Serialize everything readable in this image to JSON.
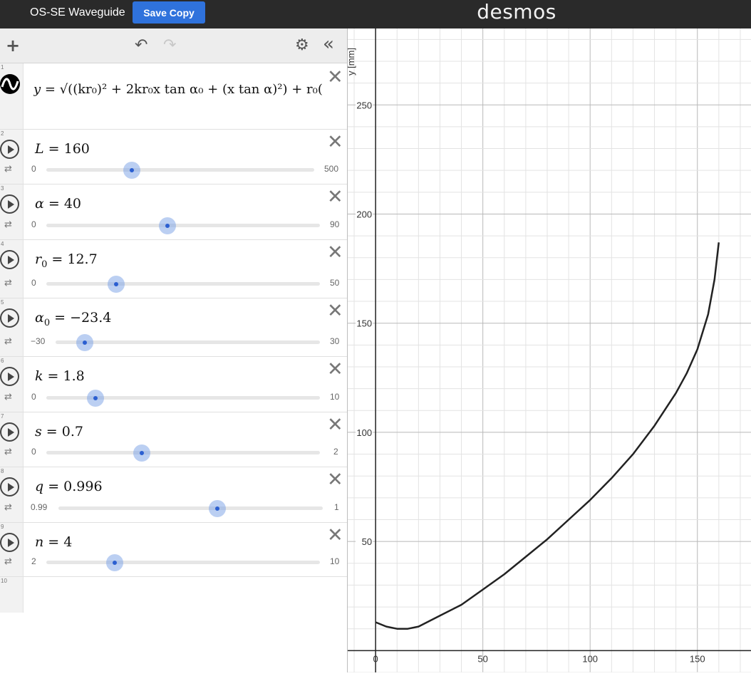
{
  "app": {
    "graph_title": "OS-SE Waveguide",
    "save_label": "Save Copy",
    "brand": "desmos"
  },
  "toolbar": {
    "add_icon": "plus-icon",
    "undo_icon": "undo-icon",
    "redo_icon": "redo-icon",
    "settings_icon": "gear-icon",
    "collapse_icon": "double-chevron-left-icon"
  },
  "expressions": {
    "function": {
      "row_number": "1",
      "lhs": "y",
      "rhs_text": "= √((kr₀)² + 2kr₀x tan α₀ + (x tan α)²) + r₀("
    },
    "sliders": [
      {
        "row_number": "2",
        "name": "L",
        "sub": "",
        "value": "160",
        "min": "0",
        "max": "500",
        "fraction": 0.32
      },
      {
        "row_number": "3",
        "name": "α",
        "sub": "",
        "value": "40",
        "min": "0",
        "max": "90",
        "fraction": 0.444
      },
      {
        "row_number": "4",
        "name": "r",
        "sub": "0",
        "value": "12.7",
        "min": "0",
        "max": "50",
        "fraction": 0.254
      },
      {
        "row_number": "5",
        "name": "α",
        "sub": "0",
        "value": "−23.4",
        "min": "−30",
        "max": "30",
        "fraction": 0.11
      },
      {
        "row_number": "6",
        "name": "k",
        "sub": "",
        "value": "1.8",
        "min": "0",
        "max": "10",
        "fraction": 0.18
      },
      {
        "row_number": "7",
        "name": "s",
        "sub": "",
        "value": "0.7",
        "min": "0",
        "max": "2",
        "fraction": 0.35
      },
      {
        "row_number": "8",
        "name": "q",
        "sub": "",
        "value": "0.996",
        "min": "0.99",
        "max": "1",
        "fraction": 0.6
      },
      {
        "row_number": "9",
        "name": "n",
        "sub": "",
        "value": "4",
        "min": "2",
        "max": "10",
        "fraction": 0.25
      }
    ],
    "empty_row_number": "10"
  },
  "chart_data": {
    "type": "line",
    "ylabel": "y [mm]",
    "x_ticks": [
      0,
      50,
      100,
      150
    ],
    "y_ticks": [
      50,
      100,
      150,
      200,
      250
    ],
    "xlim": [
      -13,
      175
    ],
    "ylim": [
      -10,
      285
    ],
    "grid": true,
    "curve_color": "#222222",
    "series": [
      {
        "x": [
          0,
          5,
          10,
          15,
          20,
          30,
          40,
          50,
          60,
          70,
          80,
          90,
          100,
          110,
          120,
          130,
          140,
          145,
          150,
          155,
          158,
          160
        ],
        "values": [
          13,
          11,
          10,
          10,
          11,
          16,
          21,
          28,
          35,
          43,
          51,
          60,
          69,
          79,
          90,
          103,
          118,
          127,
          138,
          154,
          170,
          187
        ]
      }
    ]
  }
}
